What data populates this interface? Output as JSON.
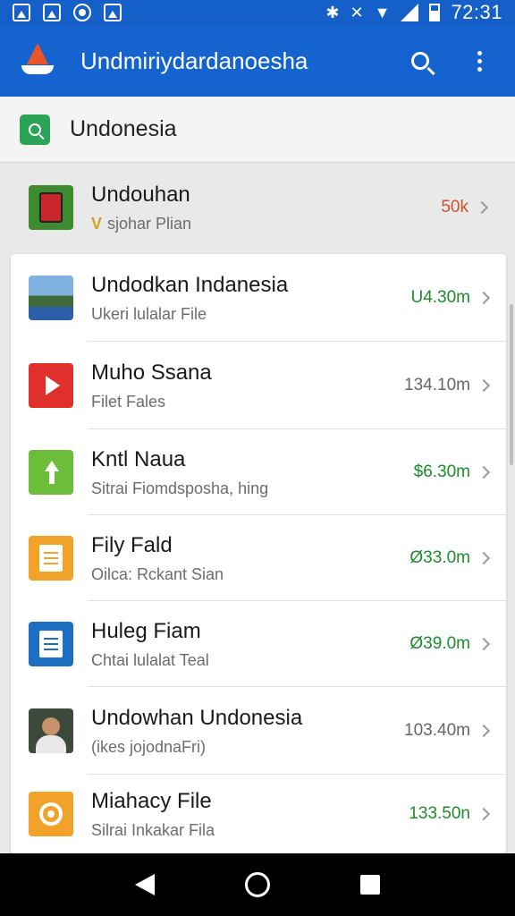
{
  "status_bar": {
    "time": "72:31",
    "icons": [
      "photo-icon",
      "image-icon",
      "circle-icon",
      "image-icon",
      "bluetooth-icon",
      "mute-icon",
      "wifi-icon",
      "signal-icon",
      "battery-icon"
    ]
  },
  "app_bar": {
    "title": "Undmiriydardanoesha",
    "logo_icon": "sailboat-icon",
    "actions": [
      "search-icon",
      "more-vert-icon"
    ]
  },
  "search": {
    "value": "Undonesia"
  },
  "featured": {
    "title": "Undouhan",
    "subtitle": "sjohar Plian",
    "subtitle_prefix": "V",
    "value": "50k",
    "value_color": "#d2502f",
    "icon": "red-book-icon"
  },
  "items": [
    {
      "title": "Undodkan Indanesia",
      "subtitle": "Ukeri lulalar File",
      "value": "U4.30m",
      "value_color": "#1a8c2a",
      "icon": "landscape-photo-icon",
      "icon_bg": "#4a8fd6"
    },
    {
      "title": "Muho Ssana",
      "subtitle": "Filet Fales",
      "value": "134.10m",
      "value_color": "#666666",
      "icon": "play-icon",
      "icon_bg": "#e0302c"
    },
    {
      "title": "Kntl Naua",
      "subtitle": "Sitrai Fiomdsposha, hing",
      "value": "$6.30m",
      "value_color": "#1a8c2a",
      "icon": "upload-arrow-icon",
      "icon_bg": "#6cbe3a"
    },
    {
      "title": "Fily Fald",
      "subtitle": "Oilca: Rckant Sian",
      "value": "Ø33.0m",
      "value_color": "#1a8c2a",
      "icon": "document-icon",
      "icon_bg": "#f2a228"
    },
    {
      "title": "Huleg Fiam",
      "subtitle": "Chtai lulalat Teal",
      "value": "Ø39.0m",
      "value_color": "#1a8c2a",
      "icon": "spreadsheet-icon",
      "icon_bg": "#1d6fc4"
    },
    {
      "title": "Undowhan Undonesia",
      "subtitle": "(ikes jojodnaFri)",
      "value": "103.40m",
      "value_color": "#666666",
      "icon": "person-photo-icon",
      "icon_bg": "#3b4a3a"
    },
    {
      "title": "Miahacy File",
      "subtitle": "Silrai Inkakar Fila",
      "value": "133.50n",
      "value_color": "#1a8c2a",
      "icon": "ring-icon",
      "icon_bg": "#f2a228"
    }
  ],
  "nav_bar": {
    "buttons": [
      "back-icon",
      "home-icon",
      "recents-icon"
    ]
  }
}
